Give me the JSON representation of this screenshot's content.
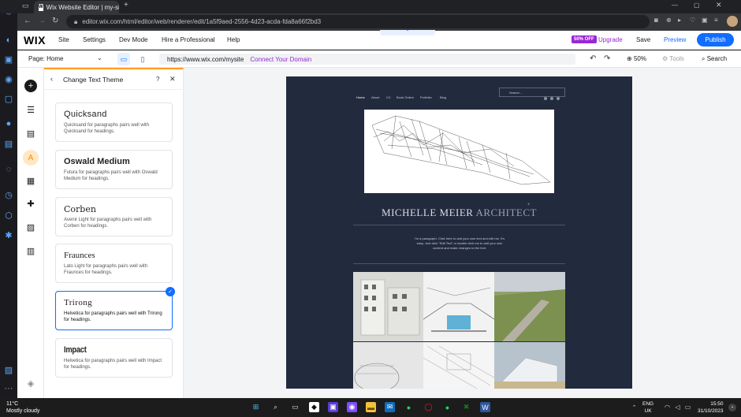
{
  "browser": {
    "tab_title": "Wix Website Editor | my-site",
    "url": "editor.wix.com/html/editor/web/renderer/edit/1a5f9aed-2556-4d23-acda-fda8a66f2bd3"
  },
  "wix_topbar": {
    "logo": "WIX",
    "menu": [
      "Site",
      "Settings",
      "Dev Mode",
      "Hire a Professional",
      "Help"
    ],
    "sale_badge": "50% OFF",
    "upgrade": "Upgrade",
    "save": "Save",
    "preview": "Preview",
    "publish": "Publish"
  },
  "toolbar": {
    "page_select": "Page: Home",
    "site_url": "https://www.wix.com/mysite",
    "connect_domain": "Connect Your Domain",
    "zoom": "50%",
    "tools": "Tools",
    "search": "Search"
  },
  "panel": {
    "title": "Change Text Theme",
    "help": "?",
    "themes": [
      {
        "name": "Quicksand",
        "desc": "Quicksand for paragraphs pairs well with Quicksand for headings."
      },
      {
        "name": "Oswald Medium",
        "desc": "Futura for paragraphs pairs well with Oswald Medium for headings."
      },
      {
        "name": "Corben",
        "desc": "Avenir Light for paragraphs pairs well with Corben for headings."
      },
      {
        "name": "Fraunces",
        "desc": "Lato Light for paragraphs pairs well with Fraunces for headings."
      },
      {
        "name": "Trirong",
        "desc": "Helvetica for paragraphs pairs well with Trirong for headings."
      },
      {
        "name": "Impact",
        "desc": "Helvetica for paragraphs pairs well with Impact for headings."
      }
    ]
  },
  "site": {
    "nav": [
      "Home",
      "About",
      "CV",
      "Book Online",
      "Portfolio",
      "Blog"
    ],
    "search_placeholder": "Search...",
    "title_main": "MICHELLE MEIER",
    "title_light": "ARCHITECT",
    "paragraph": "I'm a paragraph. Click here to add your own text and edit me. It's easy. Just click \"Edit Text\" or double click me to add your own content and make changes to the font."
  },
  "taskbar": {
    "temp": "11°C",
    "weather": "Mostly cloudy",
    "lang": "ENG",
    "region": "UK",
    "time": "15:50",
    "date": "31/10/2023"
  },
  "colors": {
    "accent": "#116dff",
    "upgrade": "#9a27d5",
    "panel_accent": "#ff9b21",
    "site_bg": "#222a3d"
  }
}
